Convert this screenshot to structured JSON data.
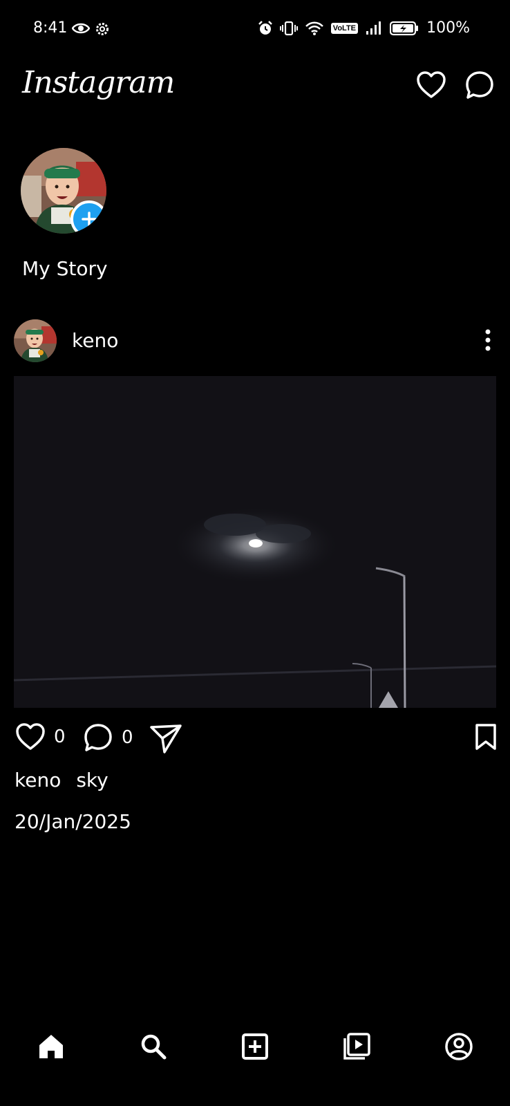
{
  "status_bar": {
    "time": "8:41",
    "battery_text": "100%",
    "icons_left": [
      "eye-icon",
      "gear-icon"
    ],
    "icons_right": [
      "alarm-icon",
      "vibrate-icon",
      "wifi-icon",
      "volte-icon",
      "signal-icon",
      "battery-icon"
    ],
    "volte_label": "VoLTE"
  },
  "header": {
    "logo_text": "Instagram",
    "actions": [
      "heart-icon",
      "messenger-icon"
    ]
  },
  "stories": [
    {
      "label": "My Story",
      "has_add_button": true
    }
  ],
  "post": {
    "username": "keno",
    "likes": "0",
    "comments": "0",
    "caption_user": "keno",
    "caption_text": "sky",
    "date": "20/Jan/2025"
  },
  "bottom_nav": {
    "items": [
      "home-icon",
      "search-icon",
      "add-post-icon",
      "reels-icon",
      "profile-icon"
    ],
    "active": "home"
  },
  "colors": {
    "background": "#000000",
    "text": "#ffffff",
    "story_add_blue": "#1ea0f0"
  }
}
